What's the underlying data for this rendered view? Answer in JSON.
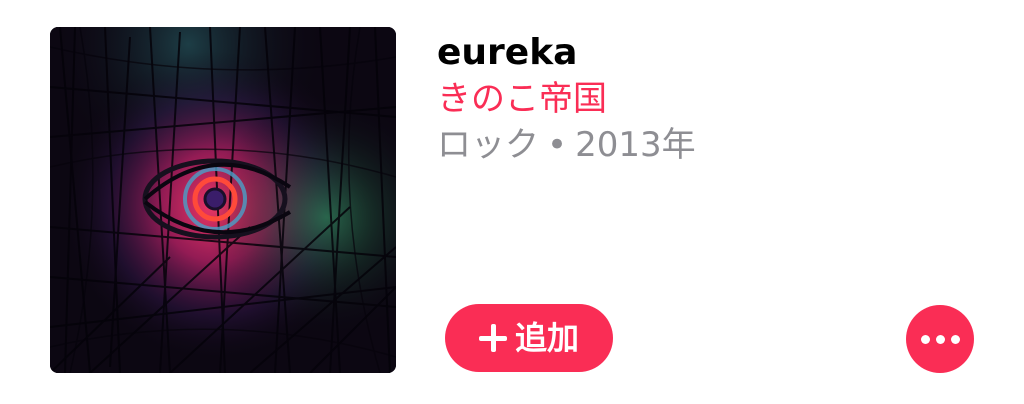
{
  "album": {
    "title": "eureka",
    "artist": "きのこ帝国",
    "genre": "ロック",
    "separator": "•",
    "year": "2013年"
  },
  "actions": {
    "add_label": "追加",
    "add_icon": "plus-icon",
    "more_icon": "more-icon"
  },
  "colors": {
    "accent": "#fa2d55",
    "secondary_text": "#8e8e93",
    "primary_text": "#000000"
  }
}
